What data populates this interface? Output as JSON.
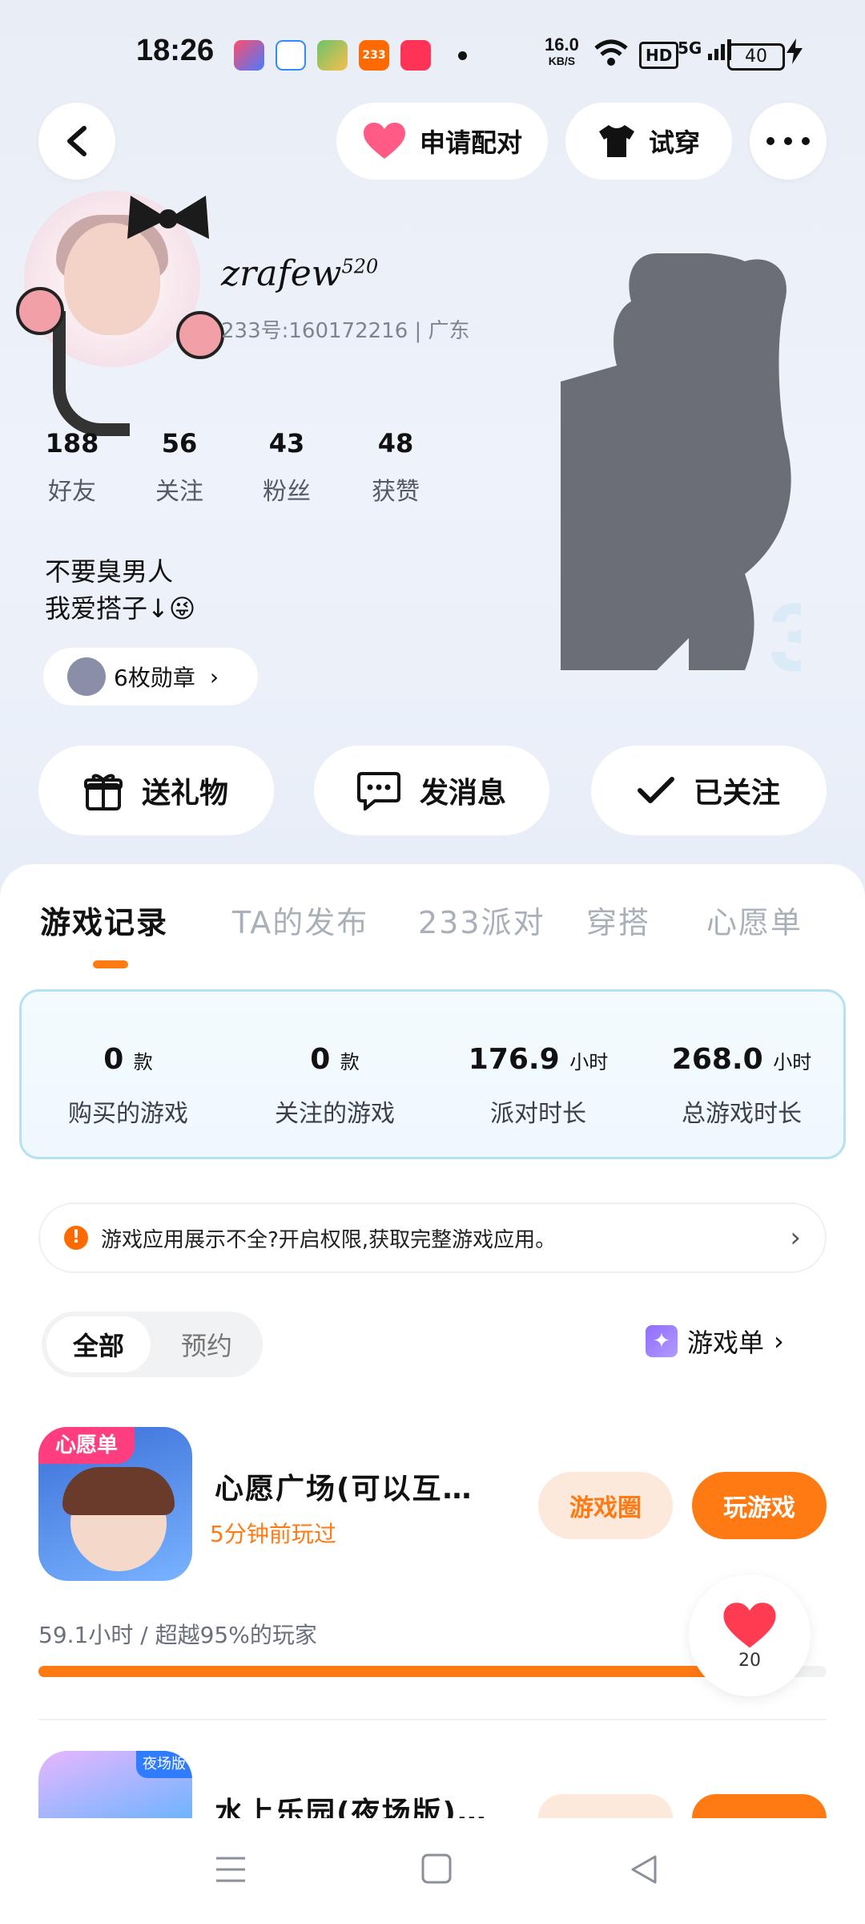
{
  "status_bar": {
    "time": "18:26",
    "net_speed": "16.0",
    "net_unit": "KB/S",
    "hd": "HD",
    "signal": "5G",
    "battery": "40"
  },
  "header": {
    "pair_label": "申请配对",
    "tryon_label": "试穿"
  },
  "profile": {
    "name": "zrafew",
    "name_sup": "520",
    "id_line": "233号:160172216 | 广东",
    "stats": [
      {
        "value": "188",
        "label": "好友"
      },
      {
        "value": "56",
        "label": "关注"
      },
      {
        "value": "43",
        "label": "粉丝"
      },
      {
        "value": "48",
        "label": "获赞"
      }
    ],
    "bio_line1": "不要臭男人",
    "bio_line2": "我爱搭子↓😜",
    "badge_label": "6枚勋章"
  },
  "actions": {
    "gift": "送礼物",
    "message": "发消息",
    "followed": "已关注"
  },
  "tabs": [
    "游戏记录",
    "TA的发布",
    "233派对",
    "穿搭",
    "心愿单"
  ],
  "summary": [
    {
      "value": "0",
      "unit": "款",
      "label": "购买的游戏"
    },
    {
      "value": "0",
      "unit": "款",
      "label": "关注的游戏"
    },
    {
      "value": "176.9",
      "unit": "小时",
      "label": "派对时长"
    },
    {
      "value": "268.0",
      "unit": "小时",
      "label": "总游戏时长"
    }
  ],
  "notice": "游戏应用展示不全?开启权限,获取完整游戏应用。",
  "filter": {
    "all": "全部",
    "reserved": "预约"
  },
  "gamelist_label": "游戏单",
  "games": [
    {
      "icon_badge": "心愿单",
      "title": "心愿广场(可以互…",
      "subtitle": "5分钟前玩过",
      "circle_btn": "游戏圈",
      "play_btn": "玩游戏",
      "playtime": "59.1小时 / 超越95%的玩家",
      "progress": 0.95
    },
    {
      "icon_badge": "夜场版",
      "title": "水上乐园(夜场版)…"
    }
  ],
  "like_count": "20",
  "colors": {
    "accent": "#ff7a12",
    "heart": "#ff3b52",
    "pair_heart": "#ff5b86"
  }
}
